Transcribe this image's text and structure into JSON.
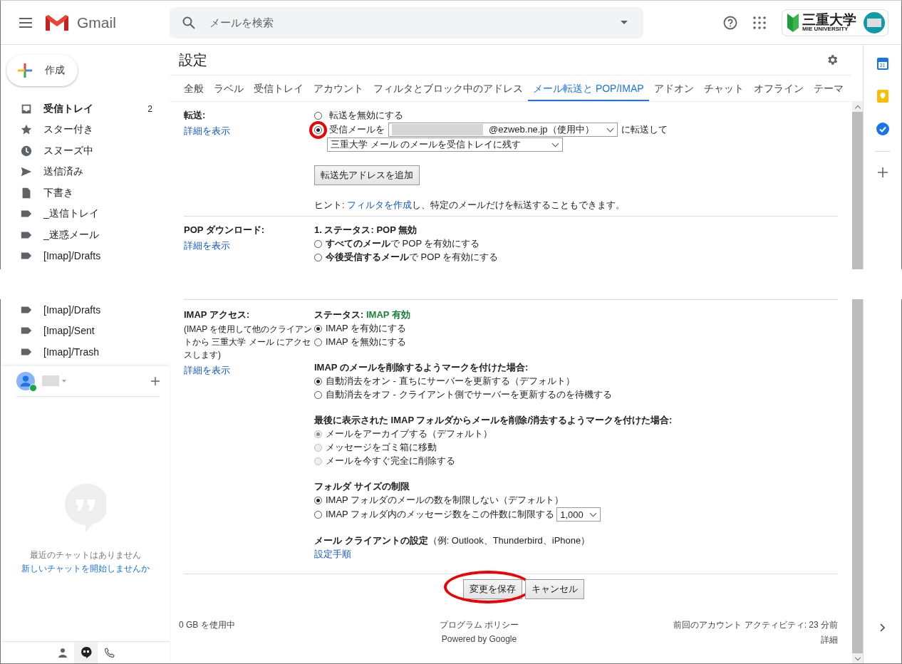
{
  "header": {
    "app_name": "Gmail",
    "search": {
      "placeholder": "メールを検索"
    },
    "org_logo": {
      "title": "三重大学",
      "subtitle": "MIE UNIVERSITY"
    }
  },
  "compose": {
    "label": "作成"
  },
  "sidebar": {
    "items": [
      {
        "label": "受信トレイ",
        "kind": "inbox",
        "count": "2",
        "unread": true
      },
      {
        "label": "スター付き",
        "kind": "star",
        "unread": false
      },
      {
        "label": "スヌーズ中",
        "kind": "clock",
        "unread": false
      },
      {
        "label": "送信済み",
        "kind": "send",
        "unread": false
      },
      {
        "label": "下書き",
        "kind": "draft",
        "unread": false
      },
      {
        "label": "_送信トレイ",
        "kind": "label",
        "unread": false
      },
      {
        "label": "_迷惑メール",
        "kind": "label",
        "unread": false
      },
      {
        "label": "[Imap]/Drafts",
        "kind": "label",
        "unread": false
      }
    ],
    "items_lower": [
      {
        "label": "[Imap]/Drafts",
        "kind": "label",
        "unread": false
      },
      {
        "label": "[Imap]/Sent",
        "kind": "label",
        "unread": false
      },
      {
        "label": "[Imap]/Trash",
        "kind": "label",
        "unread": false
      }
    ]
  },
  "chat": {
    "user_redacted": true,
    "online": true,
    "empty_text": "最近のチャットはありません",
    "start_link": "新しいチャットを開始しませんか",
    "bottom_tabs": [
      {
        "kind": "person",
        "selected": false
      },
      {
        "kind": "hangouts",
        "selected": true
      },
      {
        "kind": "phone",
        "selected": false
      }
    ]
  },
  "right_rail": {
    "calendar_day": "31"
  },
  "settings": {
    "title": "設定",
    "tabs": [
      {
        "label": "全般",
        "selected": false
      },
      {
        "label": "ラベル",
        "selected": false
      },
      {
        "label": "受信トレイ",
        "selected": false
      },
      {
        "label": "アカウント",
        "selected": false
      },
      {
        "label": "フィルタとブロック中のアドレス",
        "selected": false
      },
      {
        "label": "メール転送と POP/IMAP",
        "selected": true
      },
      {
        "label": "アドオン",
        "selected": false
      },
      {
        "label": "チャット",
        "selected": false
      },
      {
        "label": "オフライン",
        "selected": false
      },
      {
        "label": "テーマ",
        "selected": false
      }
    ],
    "forwarding": {
      "label": "転送:",
      "link": "詳細を表示",
      "options": [
        {
          "kind": "plain",
          "label": "転送を無効にする",
          "selected": false,
          "highlighted": false
        },
        {
          "kind": "address",
          "label": "受信メールを",
          "address": "@ezweb.ne.jp（使用中）",
          "address_redacted": true,
          "suffix": "に転送して",
          "selected": true,
          "highlighted": true
        }
      ],
      "action": "三重大学 メール のメールを受信トレイに残す",
      "add_button": "転送先アドレスを追加",
      "hint": "ヒント: ",
      "hint_link": "フィルタを作成",
      "hint_rest": "し、特定のメールだけを転送することもできます。"
    },
    "pop": {
      "label": "POP ダウンロード:",
      "link": "詳細を表示",
      "status": "1. ステータス: POP 無効",
      "options": [
        {
          "label": "**すべてのメール**で POP を有効にする",
          "selected": false
        },
        {
          "label": "**今後受信するメール**で POP を有効にする",
          "selected": false
        }
      ]
    },
    "imap": {
      "label": "IMAP アクセス:",
      "note": "(IMAP を使用して他のクライアントから 三重大学 メール にアクセスします)",
      "link": "詳細を表示",
      "status_label": "ステータス: ",
      "status": "IMAP 有効",
      "options": [
        {
          "label": "IMAP を有効にする",
          "selected": true
        },
        {
          "label": "IMAP を無効にする",
          "selected": false
        }
      ],
      "groups": [
        {
          "heading": "IMAP のメールを削除するようマークを付けた場合:",
          "disabled": false,
          "options": [
            {
              "label": "自動消去をオン - 直ちにサーバーを更新する（デフォルト）",
              "selected": true
            },
            {
              "label": "自動消去をオフ - クライアント側でサーバーを更新するのを待機する",
              "selected": false
            }
          ]
        },
        {
          "heading": "最後に表示された IMAP フォルダからメールを削除/消去するようマークを付けた場合:",
          "disabled": true,
          "options": [
            {
              "label": "メールをアーカイブする（デフォルト）",
              "selected": true
            },
            {
              "label": "メッセージをゴミ箱に移動",
              "selected": false
            },
            {
              "label": "メールを今すぐ完全に削除する",
              "selected": false
            }
          ]
        },
        {
          "heading": "フォルダ サイズの制限",
          "disabled": false,
          "options": [
            {
              "label": "IMAP フォルダのメールの数を制限しない（デフォルト）",
              "selected": true
            },
            {
              "label": "IMAP フォルダ内のメッセージ数をこの件数に制限する",
              "selected": false,
              "limit": "1,000"
            }
          ]
        }
      ],
      "client_heading": "メール クライアントの設定",
      "client_note": "（例: Outlook、Thunderbird、iPhone）",
      "client_link": "設定手順"
    },
    "buttons": [
      {
        "label": "変更を保存",
        "highlighted": true
      },
      {
        "label": "キャンセル",
        "highlighted": false
      }
    ]
  },
  "footer": {
    "usage": "0 GB を使用中",
    "policy": "プログラム ポリシー",
    "powered": "Powered by Google",
    "activity": "前回のアカウント アクティビティ: 23 分前",
    "details": "詳細"
  }
}
